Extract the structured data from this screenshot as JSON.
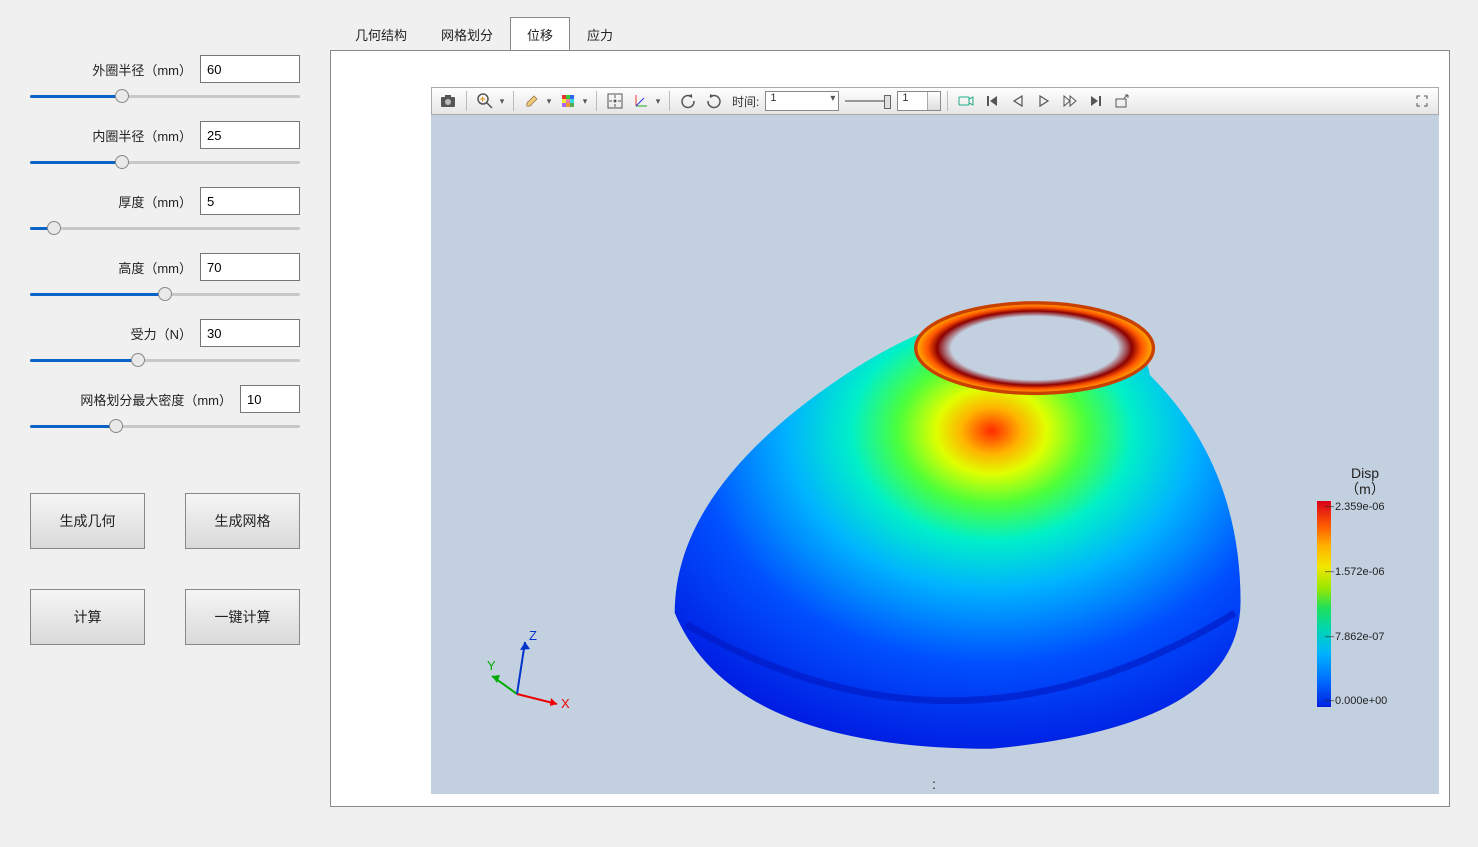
{
  "sidebar": {
    "params": [
      {
        "label": "外圈半径（mm）",
        "value": "60",
        "slider_pct": 34
      },
      {
        "label": "内圈半径（mm）",
        "value": "25",
        "slider_pct": 34
      },
      {
        "label": "厚度（mm）",
        "value": "5",
        "slider_pct": 9
      },
      {
        "label": "高度（mm）",
        "value": "70",
        "slider_pct": 50
      },
      {
        "label": "受力（N）",
        "value": "30",
        "slider_pct": 40
      },
      {
        "label": "网格划分最大密度（mm）",
        "value": "10",
        "slider_pct": 32,
        "wide_label": true
      }
    ],
    "buttons": {
      "geom": "生成几何",
      "mesh": "生成网格",
      "calc": "计算",
      "auto": "一键计算"
    }
  },
  "tabs": {
    "items": [
      "几何结构",
      "网格划分",
      "位移",
      "应力"
    ],
    "active_index": 2
  },
  "toolbar": {
    "time_label": "时间:",
    "time_value": "1",
    "frame_value": "1"
  },
  "triad": {
    "x": "X",
    "y": "Y",
    "z": "Z"
  },
  "colorbar": {
    "title_line1": "Disp",
    "title_line2": "（m）",
    "ticks": [
      "2.359e-06",
      "1.572e-06",
      "7.862e-07",
      "0.000e+00"
    ]
  },
  "status": ":",
  "chart_data": {
    "type": "heatmap",
    "title": "Disp（m）",
    "field": "displacement magnitude",
    "unit": "m",
    "range": [
      0.0,
      2.359e-06
    ],
    "tick_values": [
      2.359e-06,
      1.572e-06,
      7.862e-07,
      0.0
    ],
    "geometry_description": "truncated hollow cone, top ring shows max displacement, base shows near-zero",
    "colormap": "rainbow (blue low → red high)"
  }
}
